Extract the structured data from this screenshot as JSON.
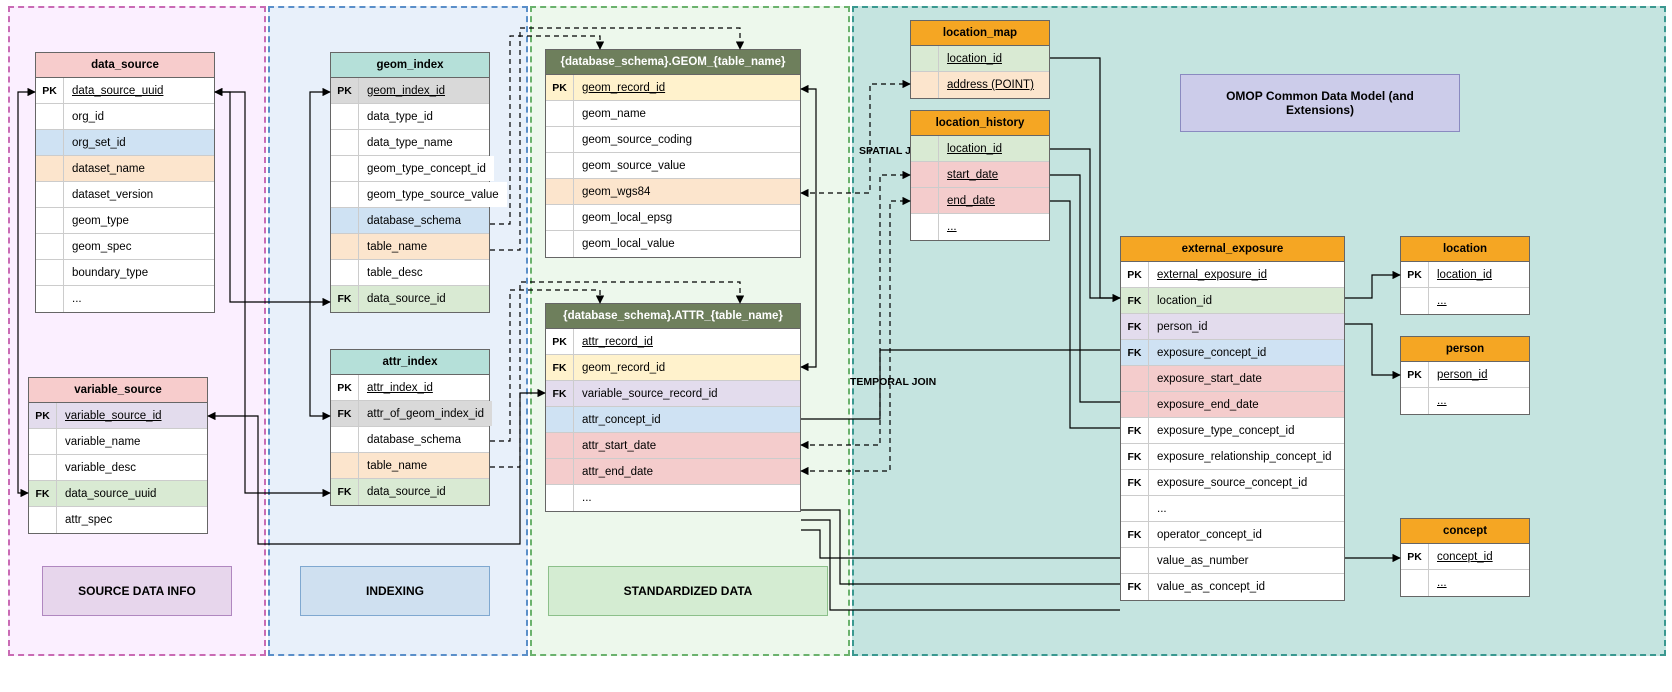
{
  "zones": {
    "source": {
      "label": "SOURCE DATA INFO"
    },
    "indexing": {
      "label": "INDEXING"
    },
    "standard": {
      "label": "STANDARDIZED DATA"
    },
    "omop": {
      "label": "OMOP Common Data Model (and Extensions)"
    }
  },
  "joins": {
    "spatial": "SPATIAL JOIN",
    "temporal": "TEMPORAL JOIN"
  },
  "tables": {
    "data_source": {
      "title": "data_source",
      "rows": [
        {
          "key": "PK",
          "name": "data_source_uuid",
          "u": true,
          "bg": "bg-white"
        },
        {
          "key": "",
          "name": "org_id",
          "bg": "bg-white"
        },
        {
          "key": "",
          "name": "org_set_id",
          "bg": "bg-blue"
        },
        {
          "key": "",
          "name": "dataset_name",
          "bg": "bg-peach"
        },
        {
          "key": "",
          "name": "dataset_version",
          "bg": "bg-white"
        },
        {
          "key": "",
          "name": "geom_type",
          "bg": "bg-white"
        },
        {
          "key": "",
          "name": "geom_spec",
          "bg": "bg-white"
        },
        {
          "key": "",
          "name": "boundary_type",
          "bg": "bg-white"
        },
        {
          "key": "",
          "name": "...",
          "bg": "bg-white"
        }
      ]
    },
    "variable_source": {
      "title": "variable_source",
      "rows": [
        {
          "key": "PK",
          "name": "variable_source_id",
          "u": true,
          "bg": "bg-lav"
        },
        {
          "key": "",
          "name": "variable_name",
          "bg": "bg-white"
        },
        {
          "key": "",
          "name": "variable_desc",
          "bg": "bg-white"
        },
        {
          "key": "FK",
          "name": "data_source_uuid",
          "bg": "bg-green"
        },
        {
          "key": "",
          "name": "attr_spec",
          "bg": "bg-white"
        }
      ]
    },
    "geom_index": {
      "title": "geom_index",
      "rows": [
        {
          "key": "PK",
          "name": "geom_index_id",
          "u": true,
          "bg": "bg-gray"
        },
        {
          "key": "",
          "name": "data_type_id",
          "bg": "bg-white"
        },
        {
          "key": "",
          "name": "data_type_name",
          "bg": "bg-white"
        },
        {
          "key": "",
          "name": "geom_type_concept_id",
          "bg": "bg-white"
        },
        {
          "key": "",
          "name": "geom_type_source_value",
          "bg": "bg-white"
        },
        {
          "key": "",
          "name": "database_schema",
          "bg": "bg-blue"
        },
        {
          "key": "",
          "name": "table_name",
          "bg": "bg-peach"
        },
        {
          "key": "",
          "name": "table_desc",
          "bg": "bg-white"
        },
        {
          "key": "FK",
          "name": "data_source_id",
          "bg": "bg-green"
        }
      ]
    },
    "attr_index": {
      "title": "attr_index",
      "rows": [
        {
          "key": "PK",
          "name": "attr_index_id",
          "u": true,
          "bg": "bg-white"
        },
        {
          "key": "FK",
          "name": "attr_of_geom_index_id",
          "bg": "bg-gray"
        },
        {
          "key": "",
          "name": "database_schema",
          "bg": "bg-white"
        },
        {
          "key": "",
          "name": "table_name",
          "bg": "bg-peach"
        },
        {
          "key": "FK",
          "name": "data_source_id",
          "bg": "bg-green"
        }
      ]
    },
    "geom_instance": {
      "title": "{database_schema}.GEOM_{table_name}",
      "rows": [
        {
          "key": "PK",
          "name": "geom_record_id",
          "u": true,
          "bg": "bg-yellow"
        },
        {
          "key": "",
          "name": "geom_name",
          "bg": "bg-white"
        },
        {
          "key": "",
          "name": "geom_source_coding",
          "bg": "bg-white"
        },
        {
          "key": "",
          "name": "geom_source_value",
          "bg": "bg-white"
        },
        {
          "key": "",
          "name": "geom_wgs84",
          "bg": "bg-peach"
        },
        {
          "key": "",
          "name": "geom_local_epsg",
          "bg": "bg-white"
        },
        {
          "key": "",
          "name": "geom_local_value",
          "bg": "bg-white"
        }
      ]
    },
    "attr_instance": {
      "title": "{database_schema}.ATTR_{table_name}",
      "rows": [
        {
          "key": "PK",
          "name": "attr_record_id",
          "u": true,
          "bg": "bg-white"
        },
        {
          "key": "FK",
          "name": "geom_record_id",
          "bg": "bg-yellow"
        },
        {
          "key": "FK",
          "name": "variable_source_record_id",
          "bg": "bg-lav"
        },
        {
          "key": "",
          "name": "attr_concept_id",
          "bg": "bg-blue"
        },
        {
          "key": "",
          "name": "attr_start_date",
          "bg": "bg-rose"
        },
        {
          "key": "",
          "name": "attr_end_date",
          "bg": "bg-rose"
        },
        {
          "key": "",
          "name": "...",
          "bg": "bg-white"
        }
      ]
    },
    "location_map": {
      "title": "location_map",
      "rows": [
        {
          "key": "",
          "name": "location_id",
          "u": true,
          "bg": "bg-green"
        },
        {
          "key": "",
          "name": "address (POINT)",
          "u": true,
          "bg": "bg-peach"
        }
      ]
    },
    "location_history": {
      "title": "location_history",
      "rows": [
        {
          "key": "",
          "name": "location_id",
          "u": true,
          "bg": "bg-green"
        },
        {
          "key": "",
          "name": "start_date",
          "u": true,
          "bg": "bg-rose"
        },
        {
          "key": "",
          "name": "end_date",
          "u": true,
          "bg": "bg-rose"
        },
        {
          "key": "",
          "name": "...",
          "u": true,
          "bg": "bg-white"
        }
      ]
    },
    "external_exposure": {
      "title": "external_exposure",
      "rows": [
        {
          "key": "PK",
          "name": "external_exposure_id",
          "u": true,
          "bg": "bg-white"
        },
        {
          "key": "FK",
          "name": "location_id",
          "bg": "bg-green"
        },
        {
          "key": "FK",
          "name": "person_id",
          "bg": "bg-lav"
        },
        {
          "key": "FK",
          "name": "exposure_concept_id",
          "bg": "bg-blue"
        },
        {
          "key": "",
          "name": "exposure_start_date",
          "bg": "bg-rose"
        },
        {
          "key": "",
          "name": "exposure_end_date",
          "bg": "bg-rose"
        },
        {
          "key": "FK",
          "name": "exposure_type_concept_id",
          "bg": "bg-white"
        },
        {
          "key": "FK",
          "name": "exposure_relationship_concept_id",
          "bg": "bg-white"
        },
        {
          "key": "FK",
          "name": "exposure_source_concept_id",
          "bg": "bg-white"
        },
        {
          "key": "",
          "name": "...",
          "bg": "bg-white"
        },
        {
          "key": "FK",
          "name": "operator_concept_id",
          "bg": "bg-white"
        },
        {
          "key": "",
          "name": "value_as_number",
          "bg": "bg-white"
        },
        {
          "key": "FK",
          "name": "value_as_concept_id",
          "bg": "bg-white"
        }
      ]
    },
    "location": {
      "title": "location",
      "rows": [
        {
          "key": "PK",
          "name": "location_id",
          "u": true,
          "bg": "bg-white"
        },
        {
          "key": "",
          "name": "...",
          "u": true,
          "bg": "bg-white"
        }
      ]
    },
    "person": {
      "title": "person",
      "rows": [
        {
          "key": "PK",
          "name": "person_id",
          "u": true,
          "bg": "bg-white"
        },
        {
          "key": "",
          "name": "...",
          "u": true,
          "bg": "bg-white"
        }
      ]
    },
    "concept": {
      "title": "concept",
      "rows": [
        {
          "key": "PK",
          "name": "concept_id",
          "u": true,
          "bg": "bg-white"
        },
        {
          "key": "",
          "name": "...",
          "u": true,
          "bg": "bg-white"
        }
      ]
    }
  }
}
